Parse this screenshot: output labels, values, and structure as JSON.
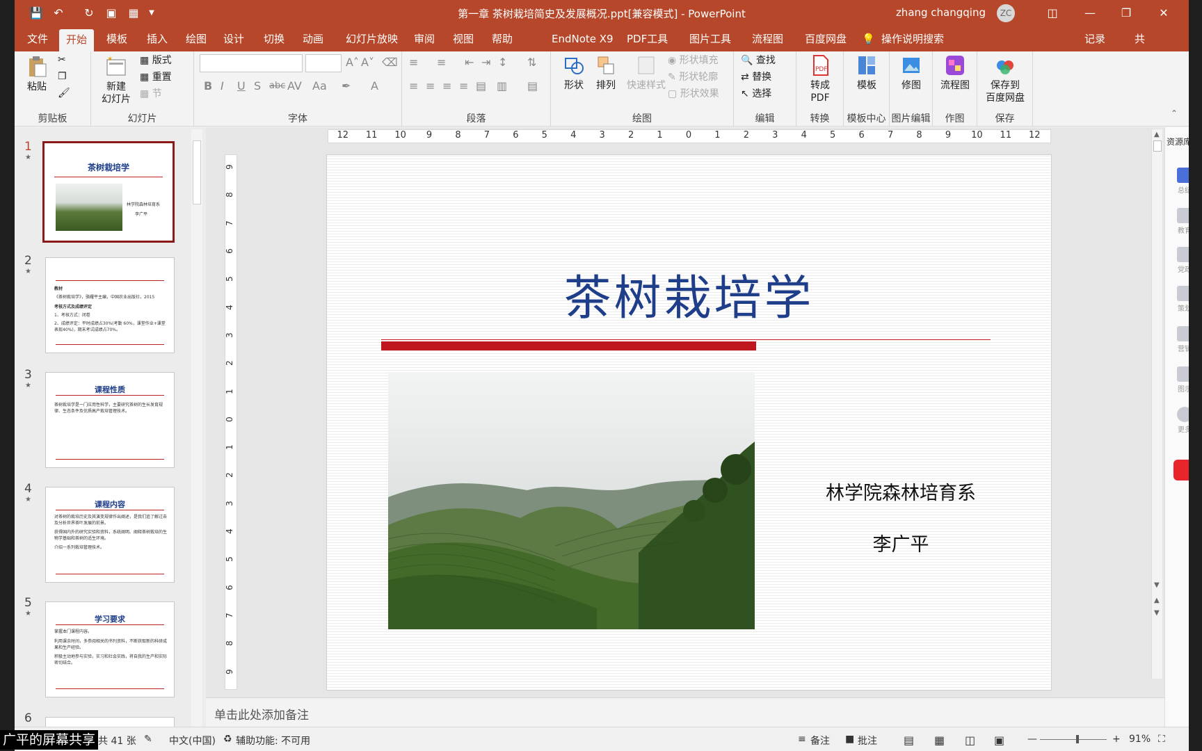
{
  "window": {
    "title": "第一章 茶树栽培简史及发展概况.ppt[兼容模式]  -  PowerPoint",
    "user": "zhang changqing",
    "avatar_initials": "ZC",
    "accent": "#b7472a"
  },
  "tabs": [
    "文件",
    "开始",
    "模板",
    "插入",
    "绘图",
    "设计",
    "切换",
    "动画",
    "幻灯片放映",
    "审阅",
    "视图",
    "帮助",
    "EndNote X9",
    "PDF工具",
    "图片工具",
    "流程图",
    "百度网盘"
  ],
  "tab_search": "操作说明搜索",
  "tab_right": {
    "record": "记录",
    "share": "共"
  },
  "ribbon": {
    "clipboard": {
      "label": "剪贴板",
      "paste": "粘贴"
    },
    "slides": {
      "label": "幻灯片",
      "new_slide_line1": "新建",
      "new_slide_line2": "幻灯片",
      "layout": "版式",
      "reset": "重置",
      "section": "节"
    },
    "font": {
      "label": "字体"
    },
    "paragraph": {
      "label": "段落"
    },
    "drawing": {
      "label": "绘图",
      "shape": "形状",
      "arrange": "排列",
      "quick_style": "快速样式",
      "shape_fill": "形状填充",
      "shape_outline": "形状轮廓",
      "shape_effect": "形状效果"
    },
    "editing": {
      "label": "编辑",
      "find": "查找",
      "replace": "替换",
      "select": "选择"
    },
    "convert": {
      "label": "转换",
      "btn_line1": "转成",
      "btn_line2": "PDF"
    },
    "template_center": {
      "label": "模板中心",
      "btn": "模板"
    },
    "image_edit": {
      "label": "图片编辑",
      "btn": "修图"
    },
    "drawing2": {
      "label": "作图",
      "btn": "流程图"
    },
    "save": {
      "label": "保存",
      "btn_line1": "保存到",
      "btn_line2": "百度网盘"
    }
  },
  "thumbnails": [
    {
      "num": "1",
      "title": "茶树栽培学",
      "lines": [
        "林学院森林培育系",
        "李广平"
      ]
    },
    {
      "num": "2",
      "title": "",
      "lines": [
        "教材",
        "《茶树栽培学》，骆耀平主编，中国农业出版社，2015",
        "考核方式及成绩评定",
        "1、考核方式：闭卷",
        "2、成绩评定：平时成绩占30%(考勤 60%，课堂作业+课堂表现40%)，期末考试成绩占70%。"
      ]
    },
    {
      "num": "3",
      "title": "课程性质",
      "lines": [
        "茶树栽培学是一门应用性科学，主要研究茶树的生长发育规律、生态条件及优质高产栽培管理技术。"
      ]
    },
    {
      "num": "4",
      "title": "课程内容",
      "lines": [
        "对茶树的栽培历史及其演变规律作出阐述，是我们追了解过去及分析世界茶叶发展的前景。",
        "获得国内外的研究实验和资料，系统阐明、阐释茶树栽培的生物学基础和茶树的适生环境。",
        "介绍一系列栽培管理技术。"
      ]
    },
    {
      "num": "5",
      "title": "学习要求",
      "lines": [
        "掌握本门课程内容。",
        "利用课余时间，多参阅相关的书刊资料，不断获取新的科研成果和生产经验。",
        "积极主动地参与实验，实习和社会实践，将自我的生产和实际密切结合。"
      ]
    },
    {
      "num": "6",
      "title": "",
      "lines": []
    }
  ],
  "slide": {
    "title": "茶树栽培学",
    "subtitle1": "林学院森林培育系",
    "subtitle2": "李广平",
    "title_color": "#1f3e8a",
    "bar_color": "#c0161d"
  },
  "notes_placeholder": "单击此处添加备注",
  "right_panel": {
    "header": "资源库",
    "items": [
      "总结",
      "教育",
      "党政",
      "策划",
      "营销",
      "图示",
      "更多"
    ]
  },
  "status": {
    "slide_count": "共 41 张",
    "language": "中文(中国)",
    "accessibility": "辅助功能: 不可用",
    "notes": "备注",
    "comments": "批注",
    "zoom": "91%"
  },
  "screen_share_label": "广平的屏幕共享",
  "ruler_h": [
    "12",
    "11",
    "10",
    "9",
    "8",
    "7",
    "6",
    "5",
    "4",
    "3",
    "2",
    "1",
    "0",
    "1",
    "2",
    "3",
    "4",
    "5",
    "6",
    "7",
    "8",
    "9",
    "10",
    "11",
    "12"
  ],
  "ruler_v": [
    "9",
    "8",
    "7",
    "6",
    "5",
    "4",
    "3",
    "2",
    "1",
    "0",
    "1",
    "2",
    "3",
    "4",
    "5",
    "6",
    "7",
    "8",
    "9"
  ]
}
